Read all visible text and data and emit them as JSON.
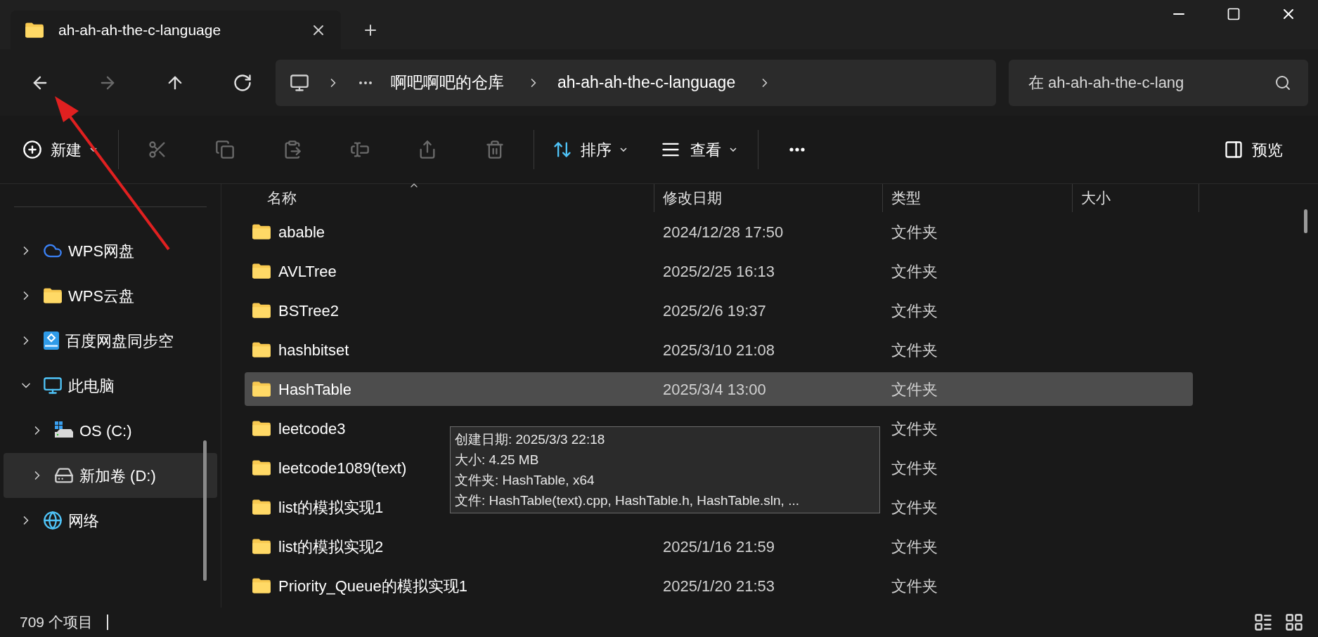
{
  "tabs": [
    {
      "title": "ah-ah-ah-the-c-language"
    }
  ],
  "nav": [
    {
      "kind": "back",
      "disabled": false
    },
    {
      "kind": "forward",
      "disabled": true
    },
    {
      "kind": "up",
      "disabled": false
    },
    {
      "kind": "refresh",
      "disabled": false
    }
  ],
  "breadcrumbs": [
    "啊吧啊吧的仓库",
    "ah-ah-ah-the-c-language"
  ],
  "search": {
    "placeholder": "在 ah-ah-ah-the-c-lang"
  },
  "toolbar": {
    "new_label": "新建",
    "icon_buttons": [
      {
        "kind": "cut",
        "disabled": true
      },
      {
        "kind": "copy",
        "disabled": true
      },
      {
        "kind": "paste",
        "disabled": true
      },
      {
        "kind": "rename",
        "disabled": true
      },
      {
        "kind": "share",
        "disabled": true
      },
      {
        "kind": "delete",
        "disabled": true
      }
    ],
    "sort_label": "排序",
    "view_label": "查看",
    "preview_label": "预览"
  },
  "sidebar": {
    "items": [
      {
        "label": "WPS网盘",
        "kind": "cloud",
        "expanded": false,
        "selected": false
      },
      {
        "label": "WPS云盘",
        "kind": "folder",
        "expanded": false,
        "selected": false
      },
      {
        "label": "百度网盘同步空",
        "kind": "sync",
        "expanded": false,
        "selected": false
      },
      {
        "label": "此电脑",
        "kind": "pc",
        "expanded": true,
        "selected": false,
        "children": [
          {
            "label": "OS (C:)",
            "kind": "system-drive",
            "expanded": false,
            "selected": false
          },
          {
            "label": "新加卷 (D:)",
            "kind": "drive",
            "expanded": false,
            "selected": true
          }
        ]
      },
      {
        "label": "网络",
        "kind": "network",
        "expanded": false,
        "selected": false
      }
    ]
  },
  "table": {
    "columns": [
      {
        "label": "名称",
        "sorted": true
      },
      {
        "label": "修改日期",
        "sorted": false
      },
      {
        "label": "类型",
        "sorted": false
      },
      {
        "label": "大小",
        "sorted": false
      }
    ],
    "rows": [
      {
        "name": "abable",
        "modified": "2024/12/28 17:50",
        "type": "文件夹",
        "selected": false
      },
      {
        "name": "AVLTree",
        "modified": "2025/2/25 16:13",
        "type": "文件夹",
        "selected": false
      },
      {
        "name": "BSTree2",
        "modified": "2025/2/6 19:37",
        "type": "文件夹",
        "selected": false
      },
      {
        "name": "hashbitset",
        "modified": "2025/3/10 21:08",
        "type": "文件夹",
        "selected": false
      },
      {
        "name": "HashTable",
        "modified": "2025/3/4 13:00",
        "type": "文件夹",
        "selected": true
      },
      {
        "name": "leetcode3",
        "type": "文件夹",
        "selected": false
      },
      {
        "name": "leetcode1089(text)",
        "type": "文件夹",
        "selected": false
      },
      {
        "name": "list的模拟实现1",
        "type": "文件夹",
        "selected": false
      },
      {
        "name": "list的模拟实现2",
        "modified": "2025/1/16 21:59",
        "type": "文件夹",
        "selected": false
      },
      {
        "name": "Priority_Queue的模拟实现1",
        "modified": "2025/1/20 21:53",
        "type": "文件夹",
        "selected": false
      }
    ]
  },
  "tooltip": [
    "创建日期: 2025/3/3 22:18",
    "大小: 4.25 MB",
    "文件夹: HashTable, x64",
    "文件: HashTable(text).cpp, HashTable.h, HashTable.sln, ..."
  ],
  "status_bar": {
    "count": "709 个项目"
  }
}
